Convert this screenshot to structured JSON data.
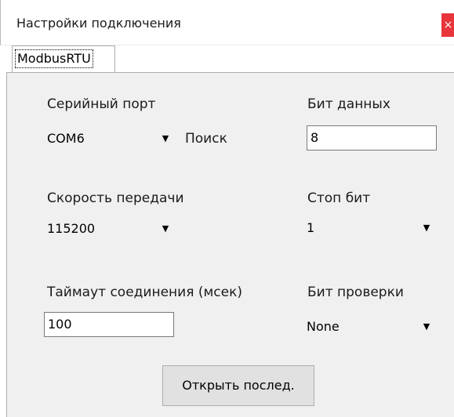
{
  "window": {
    "title": "Настройки подключения",
    "close_glyph": "×"
  },
  "tabs": [
    {
      "label": "ModbusRTU",
      "selected": true
    }
  ],
  "form": {
    "serial_port": {
      "label": "Серийный порт",
      "value": "COM6",
      "search_label": "Поиск"
    },
    "baud_rate": {
      "label": "Скорость передачи",
      "value": "115200"
    },
    "timeout": {
      "label": "Таймаут соединения (мсек)",
      "value": "100"
    },
    "data_bits": {
      "label": "Бит данных",
      "value": "8"
    },
    "stop_bits": {
      "label": "Стоп бит",
      "value": "1"
    },
    "parity": {
      "label": "Бит проверки",
      "value": "None"
    }
  },
  "open_button": {
    "label": "Открыть послед."
  },
  "icons": {
    "dropdown_arrow": "chevron-down-icon",
    "close": "close-icon"
  },
  "colors": {
    "panel_bg": "#f0f0f0",
    "close_bg": "#e8353b",
    "button_bg": "#e1e1e1"
  }
}
